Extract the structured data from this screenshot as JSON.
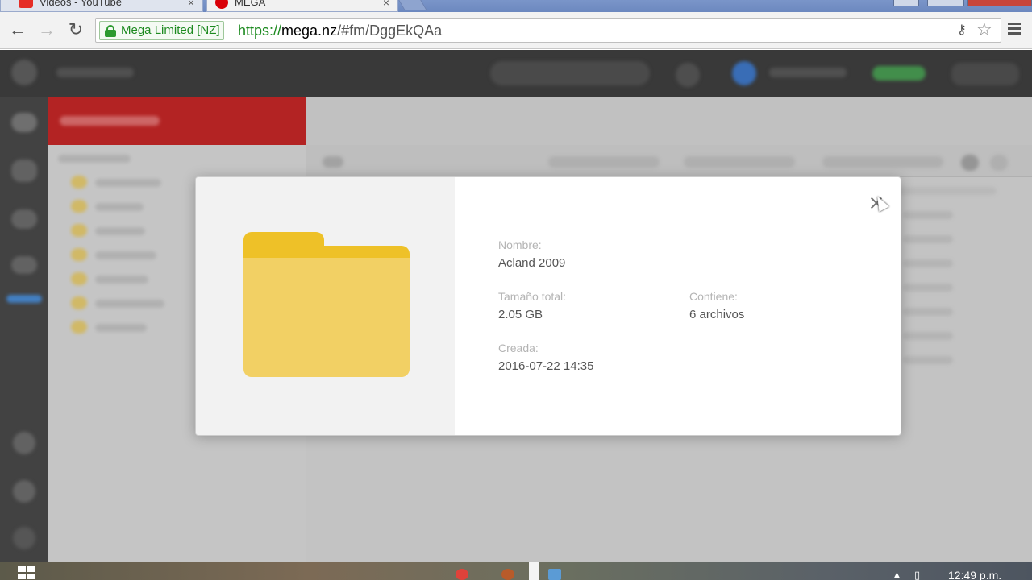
{
  "browser": {
    "tabs": [
      {
        "title": "Videos - YouTube",
        "close": "×",
        "active": false
      },
      {
        "title": "MEGA",
        "close": "×",
        "active": true
      }
    ],
    "ev_badge": "Mega Limited [NZ]",
    "url_scheme": "https://",
    "url_host": "mega.nz",
    "url_path": "/#fm/DggEkQAa",
    "icons": {
      "back": "back-arrow-icon",
      "forward": "forward-arrow-icon",
      "reload": "reload-icon",
      "lock": "lock-icon",
      "key": "key-icon",
      "star": "bookmark-star-icon",
      "menu": "hamburger-menu-icon"
    }
  },
  "dialog": {
    "fields": {
      "name_label": "Nombre:",
      "name_value": "Acland 2009",
      "size_label": "Tamaño total:",
      "size_value": "2.05 GB",
      "contains_label": "Contiene:",
      "contains_value": "6 archivos",
      "created_label": "Creada:",
      "created_value": "2016-07-22 14:35"
    },
    "colors": {
      "folder_back": "#eec128",
      "folder_front": "#f2d064",
      "label": "#b4b4b4",
      "value": "#555555"
    }
  },
  "taskbar": {
    "clock": "12:49 p.m."
  },
  "theme": {
    "mega_red": "#c10000",
    "ev_green": "#1d8a20"
  }
}
